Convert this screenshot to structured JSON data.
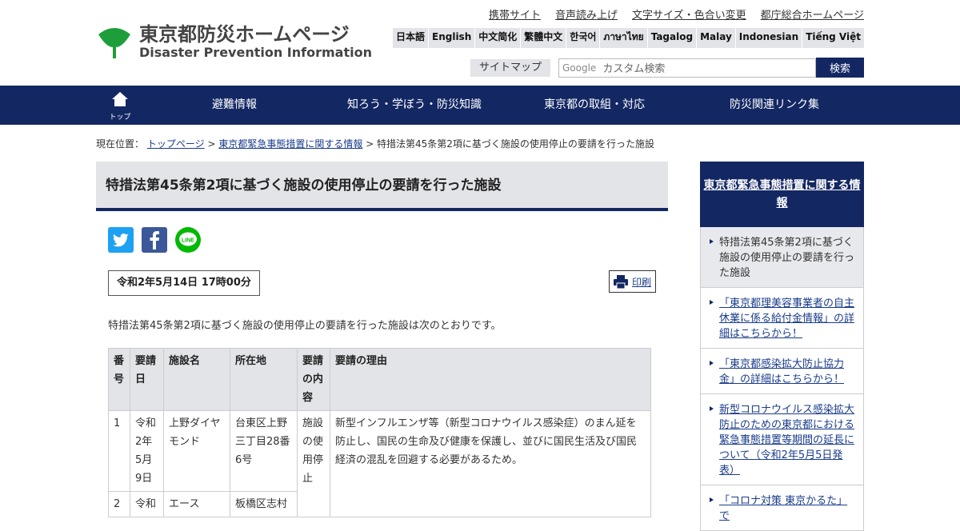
{
  "logo": {
    "ja": "東京都防災ホームページ",
    "en": "Disaster Prevention Information"
  },
  "util_links": [
    "携帯サイト",
    "音声読み上げ",
    "文字サイズ・色合い変更",
    "都庁総合ホームページ"
  ],
  "languages": [
    "日本語",
    "English",
    "中文简化",
    "繁體中文",
    "한국어",
    "ภาษาไทย",
    "Tagalog",
    "Malay",
    "Indonesian",
    "Tiếng Việt"
  ],
  "search": {
    "sitemap": "サイトマップ",
    "google": "Google",
    "placeholder": "カスタム検索",
    "button": "検索"
  },
  "nav": {
    "home": "トップ",
    "items": [
      "避難情報",
      "知ろう・学ぼう・防災知識",
      "東京都の取組・対応",
      "防災関連リンク集"
    ]
  },
  "breadcrumb": {
    "label": "現在位置：",
    "links": [
      "トップページ",
      "東京都緊急事態措置に関する情報"
    ],
    "current": "特措法第45条第2項に基づく施設の使用停止の要請を行った施設"
  },
  "main": {
    "title": "特措法第45条第2項に基づく施設の使用停止の要請を行った施設",
    "date": "令和2年5月14日 17時00分",
    "print": "印刷",
    "intro": "特措法第45条第2項に基づく施設の使用停止の要請を行った施設は次のとおりです。"
  },
  "table": {
    "headers": [
      "番号",
      "要請日",
      "施設名",
      "所在地",
      "要請の内容",
      "要請の理由"
    ],
    "rows": [
      [
        "1",
        "令和2年5月9日",
        "上野ダイヤモンド",
        "台東区上野三丁目28番6号",
        "施設の使用停止",
        "新型インフルエンザ等（新型コロナウイルス感染症）のまん延を防止し、国民の生命及び健康を保護し、並びに国民生活及び国民経済の混乱を回避する必要があるため。"
      ],
      [
        "2",
        "令和",
        "エース",
        "板橋区志村",
        "",
        ""
      ]
    ]
  },
  "sidebar": {
    "heading": "東京都緊急事態措置に関する情報",
    "items": [
      "特措法第45条第2項に基づく施設の使用停止の要請を行った施設",
      "「東京都理美容事業者の自主休業に係る給付金情報」の詳細はこちらから！",
      "「東京都感染拡大防止協力金」の詳細はこちらから！",
      "新型コロナウイルス感染拡大防止のための東京都における緊急事態措置等期間の延長について（令和2年5月5日発表）",
      "「コロナ対策 東京かるた」で"
    ]
  },
  "colors": {
    "navy": "#132763",
    "gray": "#e3e4e8",
    "link": "#1a3c8c",
    "logo_green": "#1e9e3b"
  }
}
